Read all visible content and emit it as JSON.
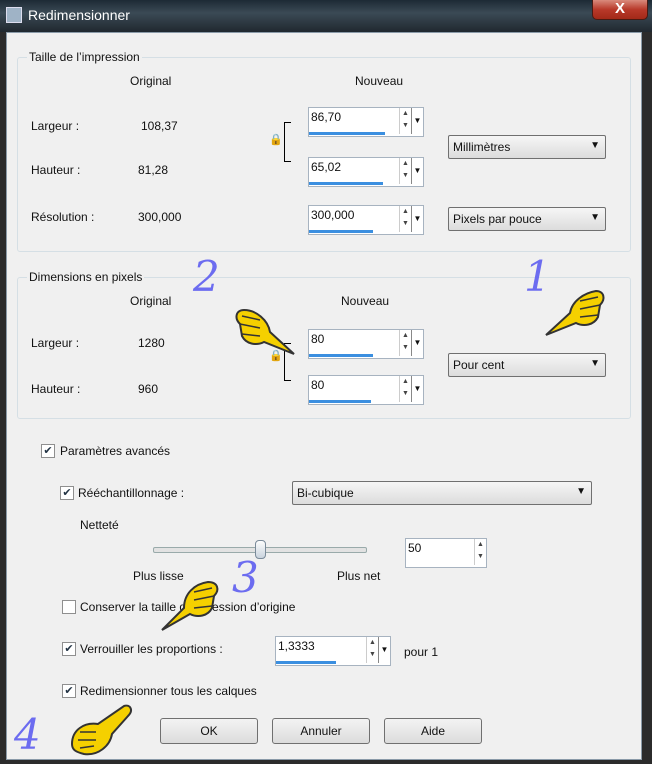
{
  "window": {
    "title": "Redimensionner",
    "close_label": "X"
  },
  "print_size": {
    "legend": "Taille de l’impression",
    "original_header": "Original",
    "new_header": "Nouveau",
    "width_label": "Largeur :",
    "width_original": "108,37",
    "width_new": "86,70",
    "height_label": "Hauteur :",
    "height_original": "81,28",
    "height_new": "65,02",
    "units": "Millimètres",
    "resolution_label": "Résolution :",
    "resolution_original": "300,000",
    "resolution_new": "300,000",
    "resolution_units": "Pixels par pouce"
  },
  "pixel_dims": {
    "legend": "Dimensions en pixels",
    "original_header": "Original",
    "new_header": "Nouveau",
    "width_label": "Largeur :",
    "width_original": "1280",
    "width_new": "80",
    "height_label": "Hauteur :",
    "height_original": "960",
    "height_new": "80",
    "units": "Pour cent"
  },
  "advanced": {
    "label": "Paramètres avancés",
    "checked": true,
    "resample_label": "Rééchantillonnage :",
    "resample_checked": true,
    "resample_method": "Bi-cubique",
    "sharpness_label": "Netteté",
    "slider_min_label": "Plus lisse",
    "slider_max_label": "Plus net",
    "sharpness_value": "50",
    "slider_level": 0.5,
    "keep_print_label": "Conserver la taille d’impression d’origine",
    "keep_print_checked": false,
    "lock_ratio_label": "Verrouiller les proportions :",
    "lock_ratio_checked": true,
    "ratio_value": "1,3333",
    "ratio_suffix": "pour 1",
    "all_layers_label": "Redimensionner tous les calques",
    "all_layers_checked": true
  },
  "buttons": {
    "ok": "OK",
    "cancel": "Annuler",
    "help": "Aide"
  },
  "annotations": {
    "n1": "1",
    "n2": "2",
    "n3": "3",
    "n4": "4"
  },
  "colors": {
    "annotation_number": "#6c6cf0",
    "hand": "#f5d000",
    "accent_bar": "#3b8fe0"
  }
}
